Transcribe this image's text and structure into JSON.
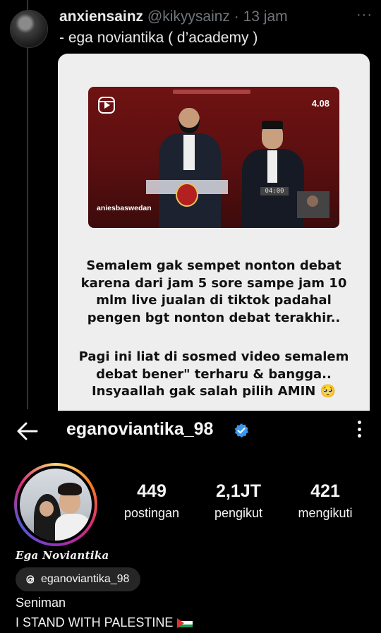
{
  "tweet": {
    "display_name": "anxiensainz",
    "handle": "@kikyysainz",
    "separator": " · ",
    "time": "13 jam",
    "text": "- ega noviantika ( d’academy )",
    "more_label": "···"
  },
  "image_card": {
    "video": {
      "version_badge": "4.08",
      "username": "aniesbaswedan",
      "timer": "04:00"
    },
    "caption_paragraph_1": [
      "Semalem gak  sempet nonton debat",
      "karena dari jam 5 sore sampe jam 10",
      "mlm live jualan di tiktok padahal",
      "pengen bgt nonton debat terakhir.."
    ],
    "caption_paragraph_2": [
      "Pagi ini liat di sosmed video semalem",
      "debat bener\" terharu & bangga..",
      "Insyaallah gak salah pilih AMIN 🥺"
    ]
  },
  "instagram_profile": {
    "username": "eganoviantika_98",
    "verified_color": "#3897f0",
    "stats": [
      {
        "value": "449",
        "label": "postingan"
      },
      {
        "value": "2,1JT",
        "label": "pengikut"
      },
      {
        "value": "421",
        "label": "mengikuti"
      }
    ],
    "display_name": "Ega Noviantika",
    "threads_handle": "eganoviantika_98",
    "bio_line_1": "Seniman",
    "bio_line_2": "I STAND WITH PALESTINE"
  }
}
